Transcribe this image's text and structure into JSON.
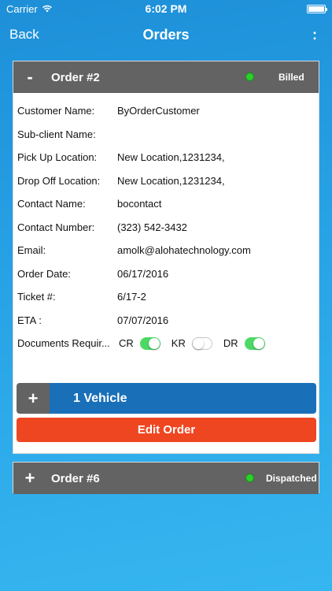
{
  "status_bar": {
    "carrier": "Carrier",
    "time": "6:02 PM"
  },
  "nav": {
    "back_label": "Back",
    "title": "Orders",
    "more_label": ":"
  },
  "orders": [
    {
      "toggle": "-",
      "title": "Order #2",
      "status": "Billed",
      "status_color": "#2bd02b",
      "fields": [
        {
          "label": "Customer Name:",
          "value": "ByOrderCustomer"
        },
        {
          "label": "Sub-client Name:",
          "value": ""
        },
        {
          "label": "Pick Up Location:",
          "value": "New Location,1231234,"
        },
        {
          "label": "Drop Off Location:",
          "value": "New Location,1231234,"
        },
        {
          "label": "Contact Name:",
          "value": "bocontact"
        },
        {
          "label": "Contact Number:",
          "value": "(323) 542-3432"
        },
        {
          "label": "Email:",
          "value": "amolk@alohatechnology.com"
        },
        {
          "label": "Order Date:",
          "value": "06/17/2016"
        },
        {
          "label": "Ticket #:",
          "value": "6/17-2"
        },
        {
          "label": "ETA :",
          "value": "07/07/2016"
        }
      ],
      "documents": {
        "label": "Documents Requir...",
        "switches": [
          {
            "label": "CR",
            "on": true
          },
          {
            "label": "KR",
            "on": false
          },
          {
            "label": "DR",
            "on": true
          }
        ]
      },
      "vehicle": {
        "plus": "+",
        "label": "1 Vehicle"
      },
      "edit_label": "Edit Order"
    },
    {
      "toggle": "+",
      "title": "Order #6",
      "status": "Dispatched",
      "status_color": "#2bd02b"
    }
  ],
  "colors": {
    "background": "#28a3e6",
    "header_gray": "#636363",
    "vehicle_blue": "#1a70b8",
    "edit_orange": "#ef4622",
    "switch_on": "#4cd964"
  },
  "icons": [
    "wifi-icon",
    "battery-icon",
    "status-dot-icon",
    "plus-icon",
    "minus-icon"
  ]
}
